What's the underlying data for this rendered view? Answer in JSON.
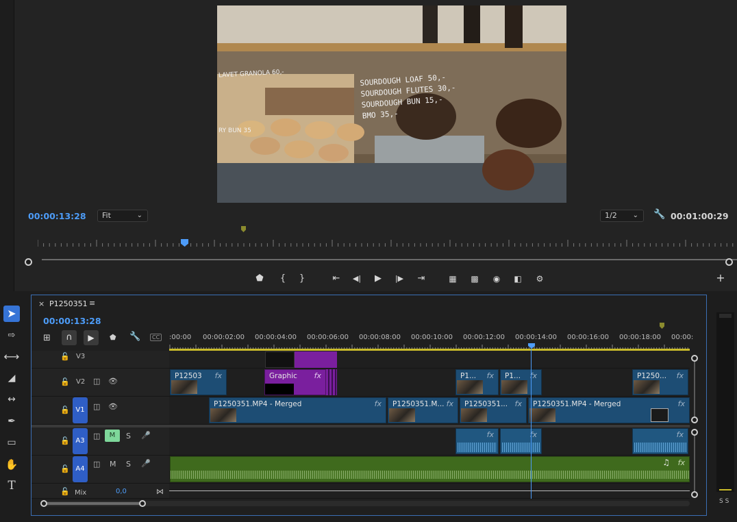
{
  "monitor": {
    "timecode_current": "00:00:13:28",
    "fit_value": "Fit",
    "resolution_value": "1/2",
    "timecode_duration": "00:01:00:29",
    "preview_text": {
      "line1": "SOURDOUGH LOAF 50,-",
      "line2": "SOURDOUGH FLUTES 30,-",
      "line3": "SOURDOUGH BUN 15,-",
      "line4": "BMO 35,-",
      "side_label": "LAVET GRANOLA 60,-",
      "side_label2": "RY BUN 35"
    },
    "transport": {
      "add_marker": "⬟",
      "mark_in": "{",
      "mark_out": "}",
      "go_to_in": "⇤",
      "step_back": "◀|",
      "play": "▶",
      "step_forward": "|▶",
      "go_to_out": "⇥",
      "lift": "lift",
      "extract": "extract",
      "export_frame": "camera",
      "compare": "compare",
      "settings": "settings",
      "add_button": "+"
    }
  },
  "timeline": {
    "sequence_name": "P1250351",
    "timecode": "00:00:13:28",
    "ruler_labels": [
      ":00:00",
      "00:00:02:00",
      "00:00:04:00",
      "00:00:06:00",
      "00:00:08:00",
      "00:00:10:00",
      "00:00:12:00",
      "00:00:14:00",
      "00:00:16:00",
      "00:00:18:00",
      "00:00:"
    ],
    "tracks": {
      "v3": {
        "name": "V3"
      },
      "v2": {
        "name": "V2"
      },
      "v1": {
        "name": "V1"
      },
      "a3": {
        "name": "A3",
        "mute": "M",
        "solo": "S"
      },
      "a4": {
        "name": "A4",
        "mute": "M",
        "solo": "S"
      },
      "mix": {
        "name": "Mix",
        "value": "0,0"
      }
    },
    "clips_v2": [
      {
        "label": "P12503"
      },
      {
        "label": "Graphic"
      },
      {
        "label": "P1..."
      },
      {
        "label": "P1..."
      },
      {
        "label": "P1250..."
      }
    ],
    "clips_v1": [
      {
        "label": "P1250351.MP4 - Merged"
      },
      {
        "label": "P1250351.M..."
      },
      {
        "label": "P1250351..."
      },
      {
        "label": "P1250351.MP4 - Merged"
      }
    ],
    "fx_label": "fx"
  },
  "meter": {
    "labels": "S S"
  },
  "colors": {
    "accent": "#4d9cf8",
    "clip_blue": "#1d4d74",
    "graphic_purple": "#7a1f9e",
    "audio_green": "#3f6a1d",
    "playhead": "#4d9cf8"
  }
}
